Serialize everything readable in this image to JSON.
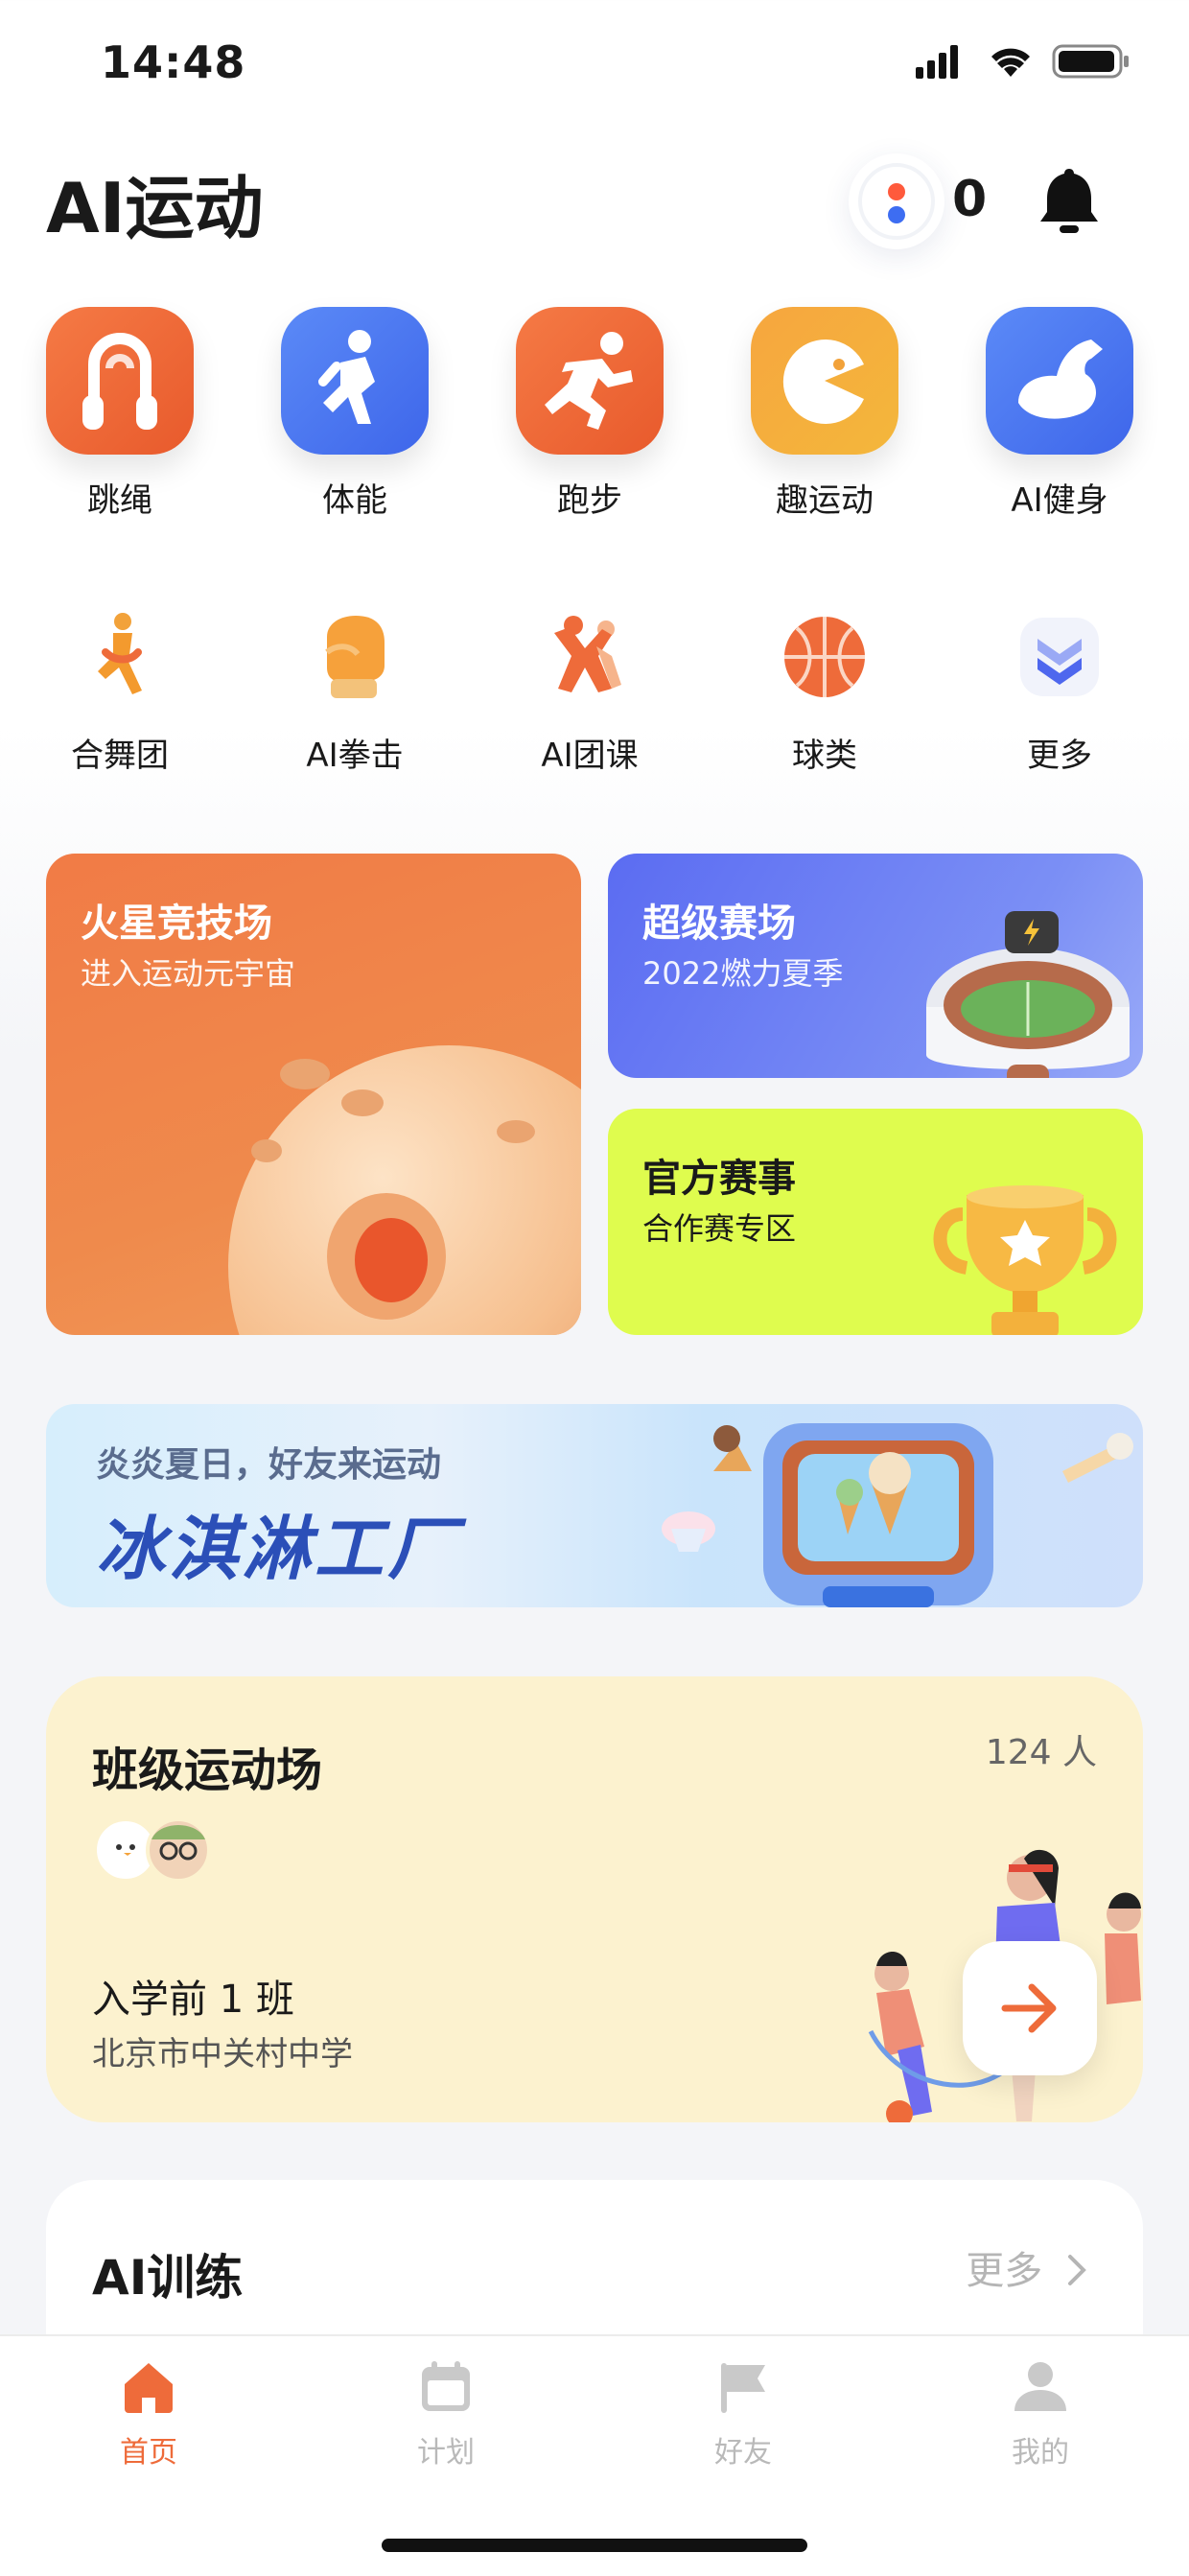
{
  "status_bar": {
    "time": "14:48"
  },
  "header": {
    "title": "AI运动",
    "points": "0"
  },
  "categories_row1": [
    {
      "label": "跳绳",
      "icon": "jump-rope-icon",
      "color": "#ee6b3a"
    },
    {
      "label": "体能",
      "icon": "fitness-person-icon",
      "color": "#4e79f1"
    },
    {
      "label": "跑步",
      "icon": "runner-icon",
      "color": "#ee6b3a"
    },
    {
      "label": "趣运动",
      "icon": "pacman-icon",
      "color": "#f2a23a"
    },
    {
      "label": "AI健身",
      "icon": "bicep-icon",
      "color": "#4e79f1"
    }
  ],
  "categories_row2": [
    {
      "label": "合舞团",
      "icon": "dancer-icon"
    },
    {
      "label": "AI拳击",
      "icon": "boxing-glove-icon"
    },
    {
      "label": "AI团课",
      "icon": "group-class-icon"
    },
    {
      "label": "球类",
      "icon": "basketball-icon"
    },
    {
      "label": "更多",
      "icon": "chevron-double-down-icon"
    }
  ],
  "cards": {
    "mars": {
      "title": "火星竞技场",
      "subtitle": "进入运动元宇宙"
    },
    "super": {
      "title": "超级赛场",
      "subtitle": "2022燃力夏季"
    },
    "official": {
      "title": "官方赛事",
      "subtitle": "合作赛专区"
    }
  },
  "banner": {
    "subtitle": "炎炎夏日，好友来运动",
    "title": "冰淇淋工厂"
  },
  "class_card": {
    "title": "班级运动场",
    "count": "124 人",
    "class_name": "入学前 1 班",
    "school": "北京市中关村中学"
  },
  "ai_training": {
    "title": "AI训练",
    "more": "更多"
  },
  "tabs": [
    {
      "label": "首页",
      "icon": "home-icon",
      "active": true
    },
    {
      "label": "计划",
      "icon": "calendar-icon",
      "active": false
    },
    {
      "label": "好友",
      "icon": "flag-icon",
      "active": false
    },
    {
      "label": "我的",
      "icon": "profile-icon",
      "active": false
    }
  ],
  "colors": {
    "accent": "#ee6b3a",
    "inactive": "#b9b9b9",
    "class_bg": "#fcf2cf",
    "official_bg": "#dffc4e"
  }
}
